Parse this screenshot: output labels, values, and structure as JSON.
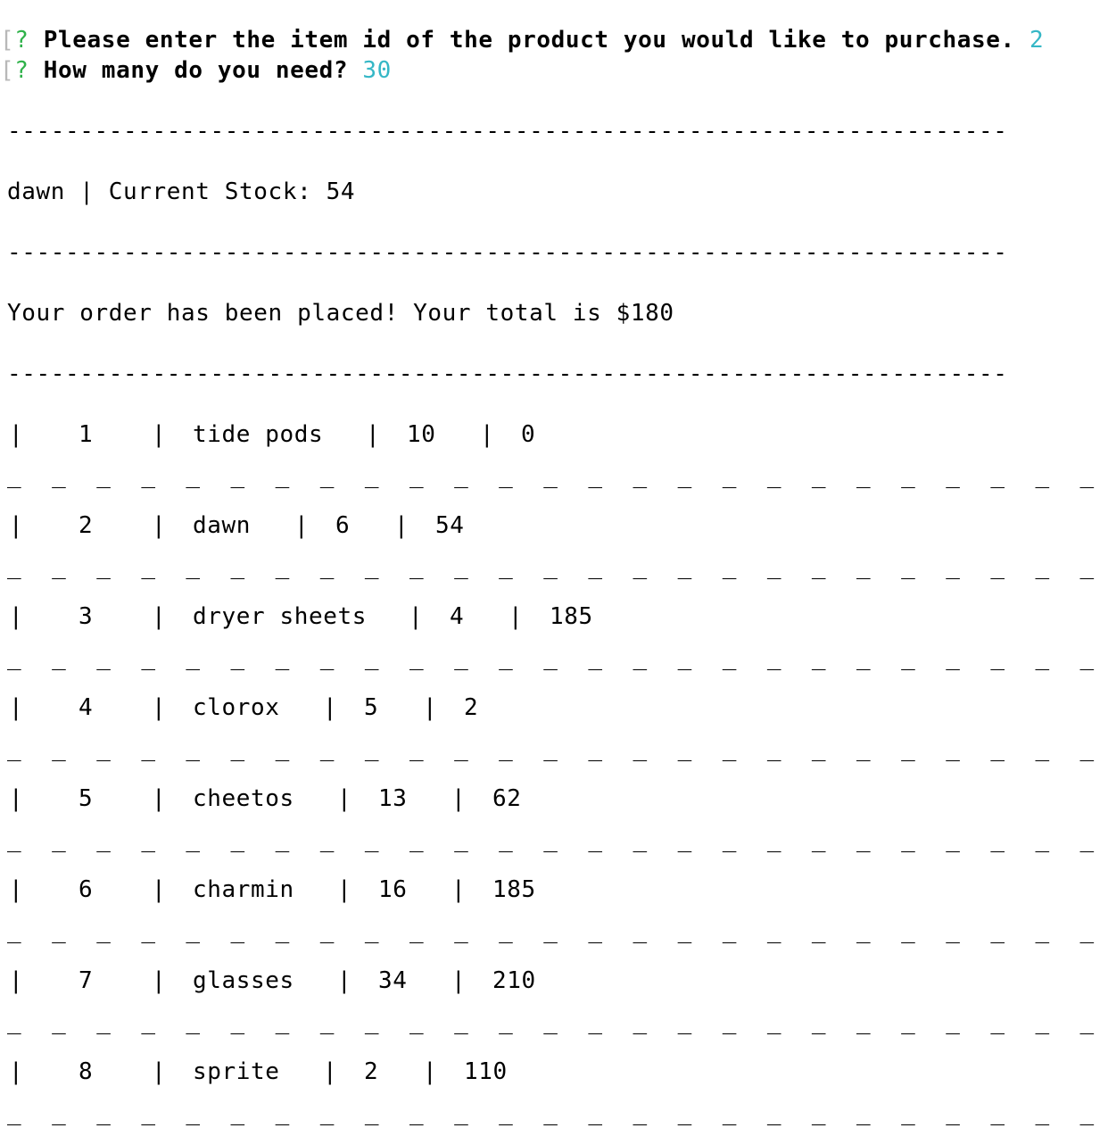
{
  "prompts": [
    {
      "bracket": "[",
      "marker": "?",
      "question": "Please enter the item id of the product you would like to purchase.",
      "answer": "2"
    },
    {
      "bracket": "[",
      "marker": "?",
      "question": "How many do you need?",
      "answer": "30"
    }
  ],
  "divider": "---------------------------------------------------------------------",
  "stock_line": "dawn | Current Stock: 54",
  "order_message": "Your order has been placed! Your total is $180",
  "row_separator": "_ _ _ _ _ _ _ _ _ _ _ _ _ _ _ _ _ _ _ _ _ _ _ _ _ _",
  "pipe": "|",
  "inventory": [
    {
      "id": "1",
      "name": "tide pods",
      "price": "10",
      "stock": "0"
    },
    {
      "id": "2",
      "name": "dawn",
      "price": "6",
      "stock": "54"
    },
    {
      "id": "3",
      "name": "dryer sheets",
      "price": "4",
      "stock": "185"
    },
    {
      "id": "4",
      "name": "clorox",
      "price": "5",
      "stock": "2"
    },
    {
      "id": "5",
      "name": "cheetos",
      "price": "13",
      "stock": "62"
    },
    {
      "id": "6",
      "name": "charmin",
      "price": "16",
      "stock": "185"
    },
    {
      "id": "7",
      "name": "glasses",
      "price": "34",
      "stock": "210"
    },
    {
      "id": "8",
      "name": "sprite",
      "price": "2",
      "stock": "110"
    }
  ],
  "colors": {
    "prompt_marker": "#2fb24a",
    "answer": "#35b7c6",
    "bracket": "#b8b8b8",
    "text": "#000000",
    "background": "#ffffff"
  }
}
